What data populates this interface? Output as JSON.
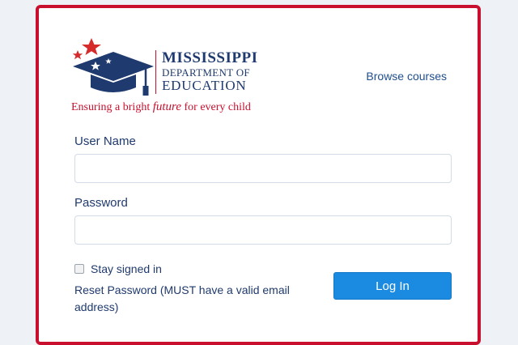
{
  "header": {
    "logo_line1": "MISSISSIPPI",
    "logo_line2": "DEPARTMENT OF",
    "logo_line3": "EDUCATION",
    "tagline_prefix": "Ensuring a bright ",
    "tagline_future": "future",
    "tagline_suffix": " for every child",
    "browse_courses": "Browse courses"
  },
  "form": {
    "username_label": "User Name",
    "username_value": "",
    "password_label": "Password",
    "password_value": "",
    "stay_signed_in_label": "Stay signed in",
    "stay_signed_in_checked": false,
    "reset_password_text": "Reset Password (MUST have a valid email address)",
    "login_button_label": "Log In"
  },
  "colors": {
    "brand_red": "#c8102e",
    "brand_navy": "#1f3a6e",
    "button_blue": "#1a8be0",
    "page_background": "#eef1f5"
  },
  "icons": {
    "logo_mark": "graduation-cap-with-stars-icon",
    "checkbox": "checkbox-icon"
  }
}
